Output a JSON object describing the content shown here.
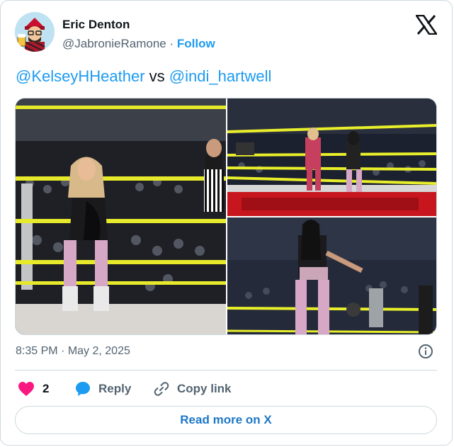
{
  "author": {
    "name": "Eric Denton",
    "handle": "@JabronieRamone",
    "separator": "·",
    "follow_label": "Follow"
  },
  "tweet": {
    "mention_1": "@KelseyHHeather",
    "connector": " vs ",
    "mention_2": "@indi_hartwell"
  },
  "media": {
    "photos": [
      {
        "description": "wrestlers-in-ring-corner-photo"
      },
      {
        "description": "wrestlers-ring-ropes-photo"
      },
      {
        "description": "wrestler-pointing-photo"
      }
    ]
  },
  "meta": {
    "time": "8:35 PM",
    "separator": " · ",
    "date": "May 2, 2025"
  },
  "actions": {
    "like_count": "2",
    "reply_label": "Reply",
    "copy_link_label": "Copy link"
  },
  "footer": {
    "read_more_label": "Read more on X"
  },
  "colors": {
    "accent": "#1d9bf0",
    "like": "#f91880",
    "text": "#0f1419",
    "secondary": "#536471",
    "rope_yellow": "#e8ef2a"
  }
}
